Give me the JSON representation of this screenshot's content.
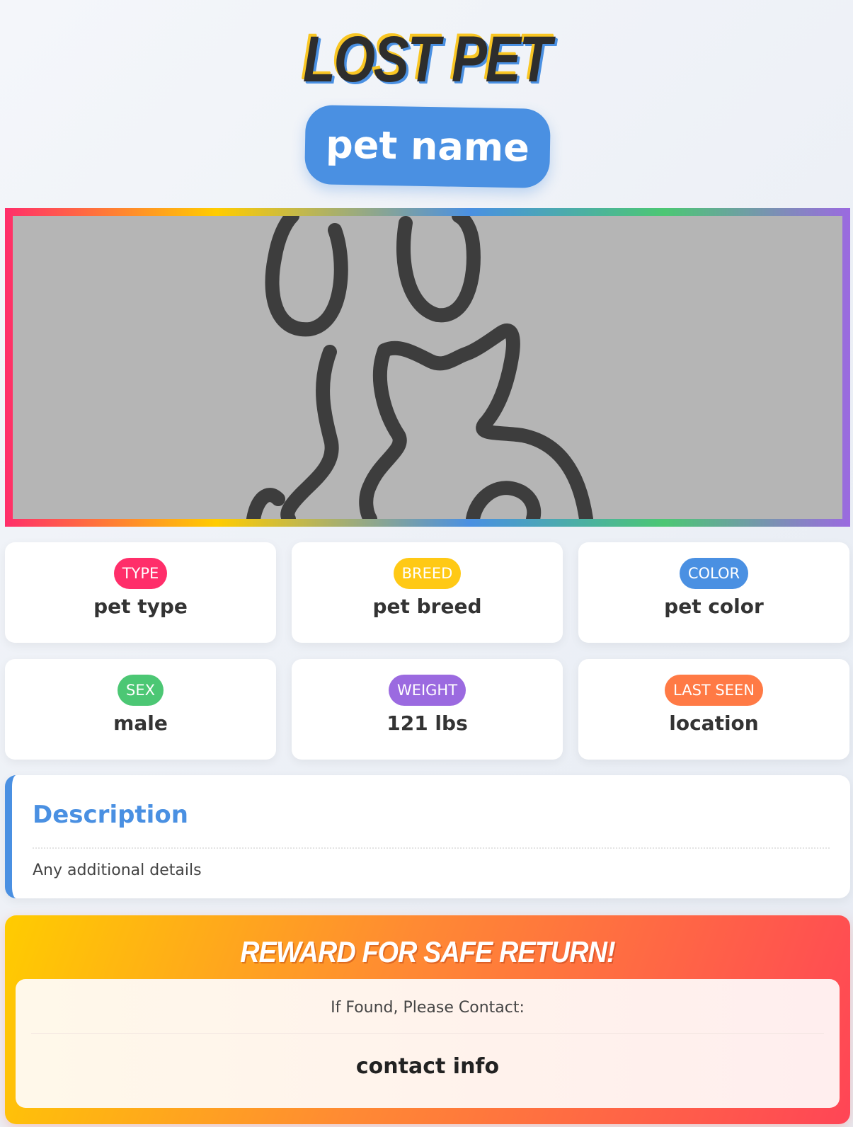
{
  "header": {
    "title": "LOST PET",
    "pet_name": "pet name"
  },
  "photo": {
    "icon": "pet-silhouette-icon"
  },
  "details": [
    {
      "label": "TYPE",
      "value": "pet type",
      "color": "#ff2e6a"
    },
    {
      "label": "BREED",
      "value": "pet breed",
      "color": "#ffc915"
    },
    {
      "label": "COLOR",
      "value": "pet color",
      "color": "#4a90e2"
    },
    {
      "label": "SEX",
      "value": "male",
      "color": "#4cc774"
    },
    {
      "label": "WEIGHT",
      "value": "121 lbs",
      "color": "#9b6ae0"
    },
    {
      "label": "LAST SEEN",
      "value": "location",
      "color": "#ff7a45"
    }
  ],
  "description": {
    "title": "Description",
    "text": "Any additional details"
  },
  "reward": {
    "title": "REWARD FOR SAFE RETURN!",
    "contact_label": "If Found, Please Contact:",
    "contact_value": "contact info"
  }
}
